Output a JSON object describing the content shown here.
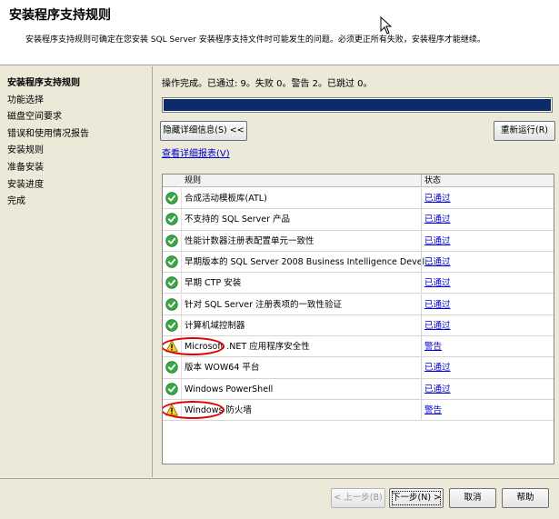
{
  "header": {
    "title": "安装程序支持规则",
    "description": "安装程序支持规则可确定在您安装 SQL Server 安装程序支持文件时可能发生的问题。必须更正所有失败，安装程序才能继续。"
  },
  "sidebar": {
    "items": [
      {
        "label": "安装程序支持规则",
        "active": true
      },
      {
        "label": "功能选择"
      },
      {
        "label": "磁盘空间要求"
      },
      {
        "label": "错误和使用情况报告"
      },
      {
        "label": "安装规则"
      },
      {
        "label": "准备安装"
      },
      {
        "label": "安装进度"
      },
      {
        "label": "完成"
      }
    ]
  },
  "main": {
    "status_text": "操作完成。已通过: 9。失败 0。警告 2。已跳过 0。",
    "progress_fraction": 1.0,
    "hide_details_label": "隐藏详细信息(S) <<",
    "rerun_label": "重新运行(R)",
    "report_link": "查看详细报表(V)",
    "columns": {
      "rule": "规则",
      "status": "状态"
    },
    "rules": [
      {
        "icon": "check-icon",
        "name": "合成活动模板库(ATL)",
        "status": "已通过"
      },
      {
        "icon": "check-icon",
        "name": "不支持的 SQL Server 产品",
        "status": "已通过"
      },
      {
        "icon": "check-icon",
        "name": "性能计数器注册表配置单元一致性",
        "status": "已通过"
      },
      {
        "icon": "check-icon",
        "name": "早期版本的 SQL Server 2008 Business Intelligence Devel...",
        "status": "已通过"
      },
      {
        "icon": "check-icon",
        "name": "早期 CTP 安装",
        "status": "已通过"
      },
      {
        "icon": "check-icon",
        "name": "针对 SQL Server 注册表项的一致性验证",
        "status": "已通过"
      },
      {
        "icon": "check-icon",
        "name": "计算机域控制器",
        "status": "已通过"
      },
      {
        "icon": "warning-icon",
        "name": "Microsoft .NET 应用程序安全性",
        "status": "警告"
      },
      {
        "icon": "check-icon",
        "name": "版本 WOW64 平台",
        "status": "已通过"
      },
      {
        "icon": "check-icon",
        "name": "Windows PowerShell",
        "status": "已通过"
      },
      {
        "icon": "warning-icon",
        "name": "Windows 防火墙",
        "status": "警告"
      }
    ]
  },
  "footer": {
    "prev_label": "< 上一步(B)",
    "next_label": "下一步(N) >",
    "cancel_label": "取消",
    "help_label": "帮助"
  },
  "colors": {
    "progress_fill": "#0b2a6a",
    "annotation_red": "#e00000",
    "link_blue": "#0000cc"
  }
}
